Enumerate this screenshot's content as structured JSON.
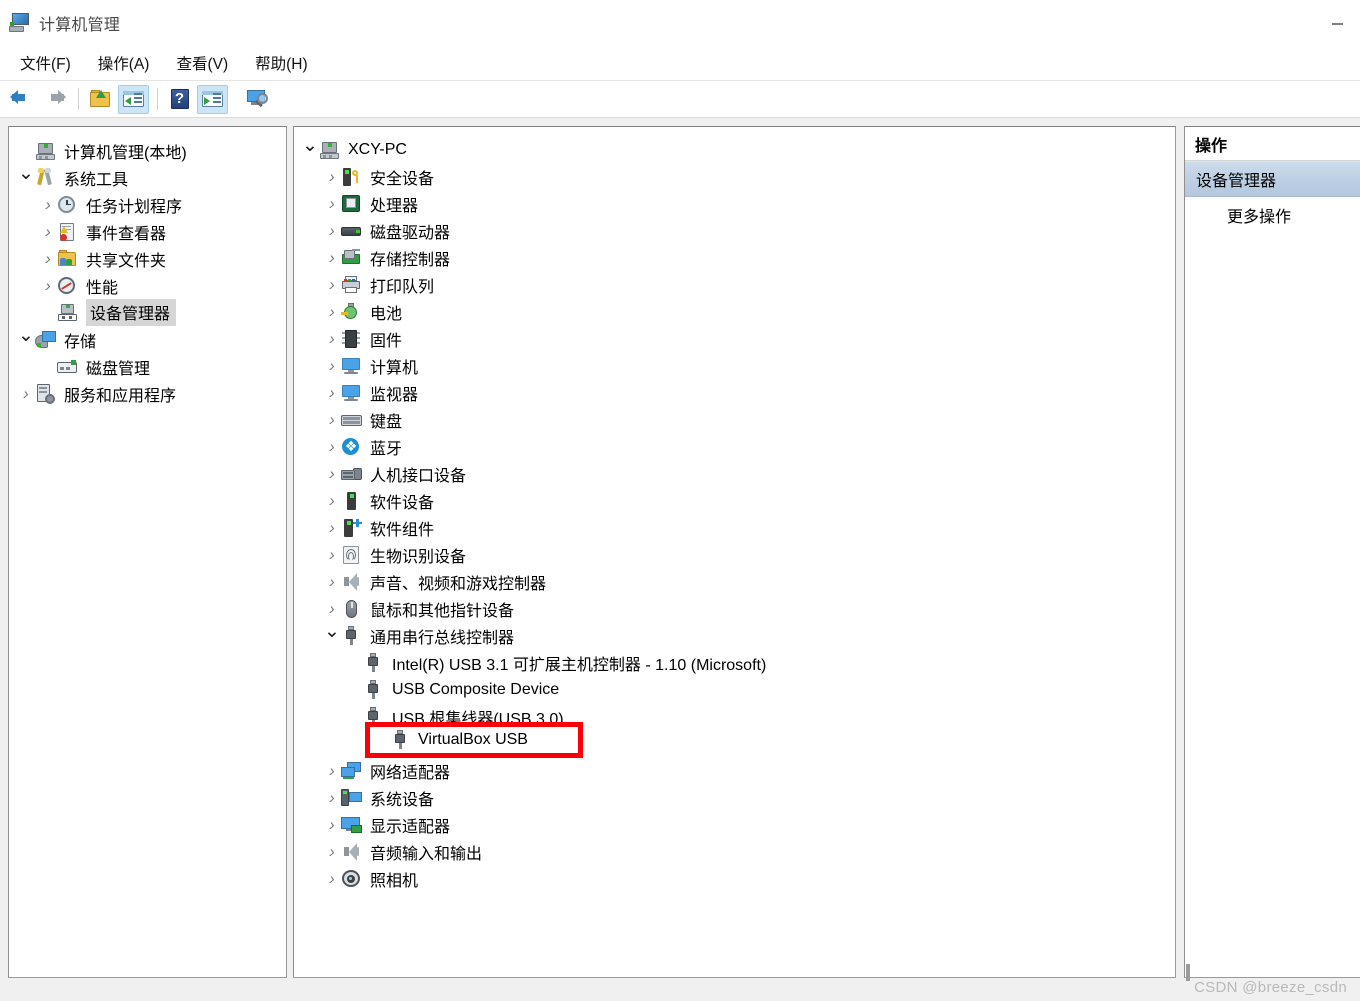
{
  "window": {
    "title": "计算机管理",
    "title_icon": "computer-management-icon",
    "minimize_label": "—"
  },
  "menubar": {
    "items": [
      {
        "label": "文件(F)",
        "name": "file"
      },
      {
        "label": "操作(A)",
        "name": "action"
      },
      {
        "label": "查看(V)",
        "name": "view"
      },
      {
        "label": "帮助(H)",
        "name": "help"
      }
    ]
  },
  "toolbar": {
    "buttons": [
      {
        "name": "back-arrow-icon",
        "icon": "arrow-left-icon",
        "active": false
      },
      {
        "name": "forward-arrow-icon",
        "icon": "arrow-right-icon",
        "active": false
      },
      {
        "name": "up-one-level-button",
        "icon": "up-folder-icon",
        "active": false
      },
      {
        "name": "show-hide-tree-button",
        "icon": "console-tree-pane-icon",
        "active": true
      },
      {
        "name": "help-button",
        "icon": "help-question-icon",
        "active": false
      },
      {
        "name": "show-hide-action-pane-button",
        "icon": "action-pane-icon",
        "active": true
      },
      {
        "name": "scan-for-hardware-changes-button",
        "icon": "scan-hardware-icon",
        "active": false
      }
    ]
  },
  "tree_panel": {
    "items": [
      {
        "label": "计算机管理(本地)",
        "level": 0,
        "twisty": "none",
        "icon": "local-computer-icon",
        "selected": false
      },
      {
        "label": "系统工具",
        "level": 0,
        "twisty": "down",
        "icon": "system-tools-icon",
        "selected": false
      },
      {
        "label": "任务计划程序",
        "level": 1,
        "twisty": "right",
        "icon": "task-scheduler-icon",
        "selected": false
      },
      {
        "label": "事件查看器",
        "level": 1,
        "twisty": "right",
        "icon": "event-viewer-icon",
        "selected": false
      },
      {
        "label": "共享文件夹",
        "level": 1,
        "twisty": "right",
        "icon": "shared-folders-icon",
        "selected": false
      },
      {
        "label": "性能",
        "level": 1,
        "twisty": "right",
        "icon": "performance-icon",
        "selected": false
      },
      {
        "label": "设备管理器",
        "level": 1,
        "twisty": "none",
        "icon": "device-manager-icon",
        "selected": true
      },
      {
        "label": "存储",
        "level": 0,
        "twisty": "down",
        "icon": "storage-icon",
        "selected": false
      },
      {
        "label": "磁盘管理",
        "level": 1,
        "twisty": "none",
        "icon": "disk-management-icon",
        "selected": false
      },
      {
        "label": "服务和应用程序",
        "level": 0,
        "twisty": "right",
        "icon": "services-apps-icon",
        "selected": false
      }
    ]
  },
  "device_tree": {
    "items": [
      {
        "label": "XCY-PC",
        "level": 0,
        "twisty": "down",
        "icon": "computer-node-icon"
      },
      {
        "label": "安全设备",
        "level": 1,
        "twisty": "right",
        "icon": "security-device-icon"
      },
      {
        "label": "处理器",
        "level": 1,
        "twisty": "right",
        "icon": "processor-icon"
      },
      {
        "label": "磁盘驱动器",
        "level": 1,
        "twisty": "right",
        "icon": "disk-drive-icon"
      },
      {
        "label": "存储控制器",
        "level": 1,
        "twisty": "right",
        "icon": "storage-controller-icon"
      },
      {
        "label": "打印队列",
        "level": 1,
        "twisty": "right",
        "icon": "print-queue-icon"
      },
      {
        "label": "电池",
        "level": 1,
        "twisty": "right",
        "icon": "battery-icon"
      },
      {
        "label": "固件",
        "level": 1,
        "twisty": "right",
        "icon": "firmware-icon"
      },
      {
        "label": "计算机",
        "level": 1,
        "twisty": "right",
        "icon": "computer-icon"
      },
      {
        "label": "监视器",
        "level": 1,
        "twisty": "right",
        "icon": "monitor-icon"
      },
      {
        "label": "键盘",
        "level": 1,
        "twisty": "right",
        "icon": "keyboard-icon"
      },
      {
        "label": "蓝牙",
        "level": 1,
        "twisty": "right",
        "icon": "bluetooth-icon"
      },
      {
        "label": "人机接口设备",
        "level": 1,
        "twisty": "right",
        "icon": "hid-icon"
      },
      {
        "label": "软件设备",
        "level": 1,
        "twisty": "right",
        "icon": "software-device-icon"
      },
      {
        "label": "软件组件",
        "level": 1,
        "twisty": "right",
        "icon": "software-component-icon"
      },
      {
        "label": "生物识别设备",
        "level": 1,
        "twisty": "right",
        "icon": "biometric-device-icon"
      },
      {
        "label": "声音、视频和游戏控制器",
        "level": 1,
        "twisty": "right",
        "icon": "sound-video-game-icon"
      },
      {
        "label": "鼠标和其他指针设备",
        "level": 1,
        "twisty": "right",
        "icon": "mouse-icon"
      },
      {
        "label": "通用串行总线控制器",
        "level": 1,
        "twisty": "down",
        "icon": "usb-controller-icon"
      },
      {
        "label": "Intel(R) USB 3.1 可扩展主机控制器 - 1.10 (Microsoft)",
        "level": 2,
        "twisty": "none",
        "icon": "usb-device-icon"
      },
      {
        "label": "USB Composite Device",
        "level": 2,
        "twisty": "none",
        "icon": "usb-device-icon"
      },
      {
        "label": "USB 根集线器(USB 3.0)",
        "level": 2,
        "twisty": "none",
        "icon": "usb-device-icon"
      },
      {
        "label": "VirtualBox USB",
        "level": 2,
        "twisty": "none",
        "icon": "usb-device-icon"
      },
      {
        "label": "网络适配器",
        "level": 1,
        "twisty": "right",
        "icon": "network-adapter-icon"
      },
      {
        "label": "系统设备",
        "level": 1,
        "twisty": "right",
        "icon": "system-device-icon"
      },
      {
        "label": "显示适配器",
        "level": 1,
        "twisty": "right",
        "icon": "display-adapter-icon"
      },
      {
        "label": "音频输入和输出",
        "level": 1,
        "twisty": "right",
        "icon": "audio-io-icon"
      },
      {
        "label": "照相机",
        "level": 1,
        "twisty": "right",
        "icon": "camera-icon"
      }
    ]
  },
  "highlight": {
    "label": "VirtualBox USB",
    "icon": "usb-device-icon",
    "border_color": "#fb0007"
  },
  "action_panel": {
    "header": "操作",
    "selected_item": "设备管理器",
    "more_actions": "更多操作"
  },
  "watermark": {
    "text": "CSDN @breeze_csdn"
  },
  "colors": {
    "selection_blue": "#bed0e4",
    "tree_selection_gray": "#d6d6d6",
    "toolbar_active": "#cde6f7",
    "highlight_red": "#fb0007",
    "window_bg": "#f0f0f0"
  }
}
